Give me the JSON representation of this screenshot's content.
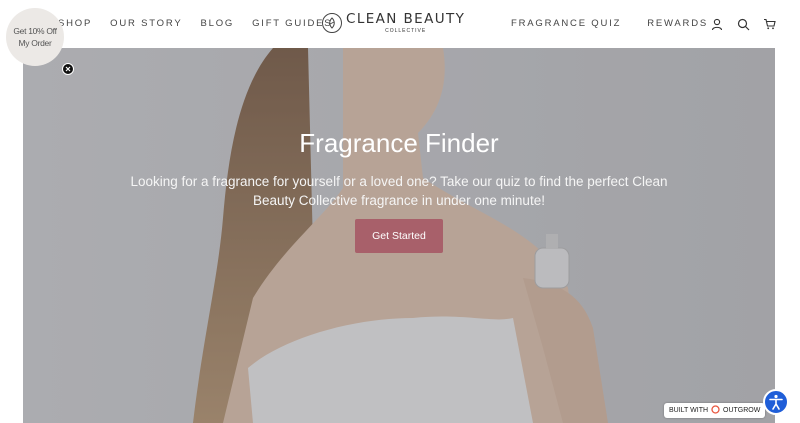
{
  "header": {
    "nav_left": [
      "SHOP",
      "OUR STORY",
      "BLOG",
      "GIFT GUIDES"
    ],
    "nav_right": [
      "FRAGRANCE QUIZ",
      "REWARDS"
    ],
    "logo": {
      "main": "CLEAN BEAUTY",
      "sub": "COLLECTIVE"
    },
    "icons": [
      "account-icon",
      "search-icon",
      "cart-icon"
    ]
  },
  "discount": {
    "line1": "Get 10% Off",
    "line2": "My Order"
  },
  "hero": {
    "title": "Fragrance Finder",
    "description": "Looking for a fragrance for yourself or a loved one? Take our quiz to find the perfect Clean Beauty Collective fragrance in under one minute!",
    "cta_label": "Get Started"
  },
  "badge": {
    "label": "BUILT WITH",
    "brand": "OUTGROW"
  },
  "colors": {
    "cta": "#a8606a",
    "accessibility": "#1f5ed8"
  }
}
